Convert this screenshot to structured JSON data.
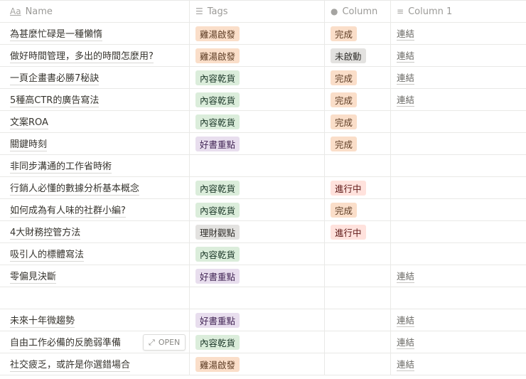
{
  "headers": {
    "name": "Name",
    "tags": "Tags",
    "column": "Column",
    "column1": "Column 1"
  },
  "icons": {
    "name": "text-icon",
    "tags": "list-icon",
    "column": "select-icon",
    "column1": "lines-icon"
  },
  "open_label": "OPEN",
  "tag_colors": {
    "雞湯啟發": [
      "#fadec9",
      "#5c3b23"
    ],
    "內容乾貨": [
      "#dbeddb",
      "#1c3829"
    ],
    "好書重點": [
      "#e8deee",
      "#412454"
    ],
    "理財觀點": [
      "#e3e2e0",
      "#32302c"
    ],
    "完成": [
      "#fadec9",
      "#5c3b23"
    ],
    "未啟動": [
      "#e3e2e0",
      "#32302c"
    ],
    "進行中": [
      "#ffe2dd",
      "#5d1715"
    ]
  },
  "rows": [
    {
      "name": "為甚麼忙碌是一種懶惰",
      "tag": "雞湯啟發",
      "status": "完成",
      "link": "連結"
    },
    {
      "name": "做好時間管理，多出的時間怎麼用?",
      "tag": "雞湯啟發",
      "status": "未啟動",
      "link": "連結"
    },
    {
      "name": "一頁企畫書必勝7秘訣",
      "tag": "內容乾貨",
      "status": "完成",
      "link": "連結"
    },
    {
      "name": "5種高CTR的廣告寫法",
      "tag": "內容乾貨",
      "status": "完成",
      "link": "連結"
    },
    {
      "name": "文案ROA",
      "tag": "內容乾貨",
      "status": "完成",
      "link": ""
    },
    {
      "name": "關鍵時刻",
      "tag": "好書重點",
      "status": "完成",
      "link": ""
    },
    {
      "name": "非同步溝通的工作省時術",
      "tag": "",
      "status": "",
      "link": ""
    },
    {
      "name": "行銷人必懂的數據分析基本概念",
      "tag": "內容乾貨",
      "status": "進行中",
      "link": ""
    },
    {
      "name": "如何成為有人味的社群小編?",
      "tag": "內容乾貨",
      "status": "完成",
      "link": ""
    },
    {
      "name": "4大財務控管方法",
      "tag": "理財觀點",
      "status": "進行中",
      "link": ""
    },
    {
      "name": "吸引人的標體寫法",
      "tag": "內容乾貨",
      "status": "",
      "link": ""
    },
    {
      "name": "零偏見決斷",
      "tag": "好書重點",
      "status": "",
      "link": "連結"
    },
    {
      "name": "",
      "tag": "",
      "status": "",
      "link": ""
    },
    {
      "name": "未來十年微趨勢",
      "tag": "好書重點",
      "status": "",
      "link": "連結"
    },
    {
      "name": "自由工作必備的反脆弱準備",
      "tag": "內容乾貨",
      "status": "",
      "link": "連結",
      "hover": true
    },
    {
      "name": "社交疲乏，或許是你選錯場合",
      "tag": "雞湯啟發",
      "status": "",
      "link": "連結"
    }
  ]
}
